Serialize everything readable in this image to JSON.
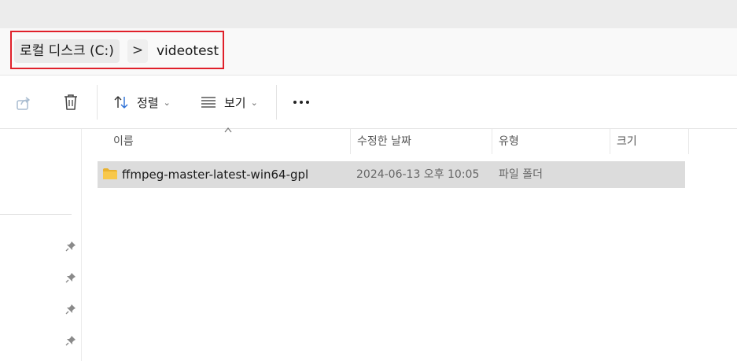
{
  "breadcrumb": {
    "root": "로컬 디스크 (C:)",
    "separator": ">",
    "current": "videotest"
  },
  "toolbar": {
    "share_icon": "share-icon",
    "delete_icon": "trash-icon",
    "sort_label": "정렬",
    "view_label": "보기",
    "more_icon": "more-icon"
  },
  "columns": {
    "name": "이름",
    "modified": "수정한 날짜",
    "type": "유형",
    "size": "크기"
  },
  "files": [
    {
      "name": "ffmpeg-master-latest-win64-gpl",
      "modified": "2024-06-13 오후 10:05",
      "type": "파일 폴더",
      "size": "",
      "icon": "folder-icon"
    }
  ],
  "colors": {
    "highlight_border": "#e0202a",
    "folder_yellow": "#f8c84b",
    "sort_accent": "#2b6fd6",
    "selected_row": "#dcdcdc"
  }
}
